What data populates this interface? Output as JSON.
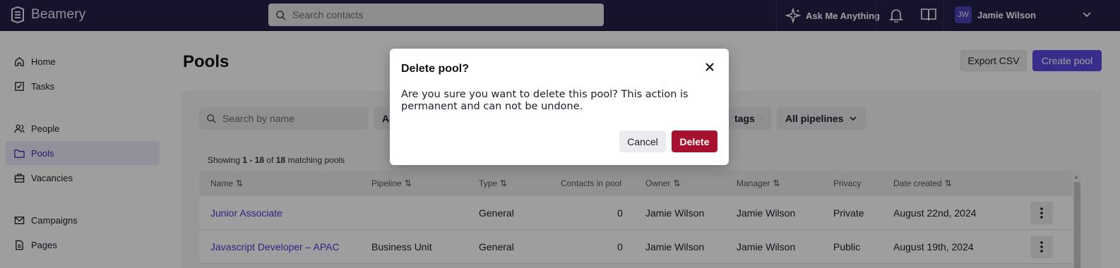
{
  "app": {
    "brand": "Beamery"
  },
  "topbar": {
    "search_placeholder": "Search contacts",
    "ask_label": "Ask Me Anything",
    "user": {
      "initials": "JW",
      "name": "Jamie Wilson"
    }
  },
  "sidebar": {
    "items": [
      {
        "label": "Home",
        "icon": "home-icon"
      },
      {
        "label": "Tasks",
        "icon": "tasks-icon"
      },
      {
        "label": "People",
        "icon": "people-icon"
      },
      {
        "label": "Pools",
        "icon": "pools-icon",
        "active": true
      },
      {
        "label": "Vacancies",
        "icon": "briefcase-icon"
      },
      {
        "label": "Campaigns",
        "icon": "mail-icon"
      },
      {
        "label": "Pages",
        "icon": "pages-icon"
      }
    ]
  },
  "main": {
    "title": "Pools",
    "export_label": "Export CSV",
    "create_label": "Create pool",
    "search_placeholder": "Search by name",
    "filter_partial": "A",
    "filters": [
      "tags",
      "All pipelines"
    ],
    "showing": {
      "prefix": "Showing ",
      "range": "1 - 18",
      "mid": " of ",
      "total": "18",
      "suffix": " matching pools"
    }
  },
  "table": {
    "columns": [
      {
        "label": "Name",
        "sortable": true
      },
      {
        "label": "Pipeline",
        "sortable": true
      },
      {
        "label": "Type",
        "sortable": true
      },
      {
        "label": "Contacts in pool",
        "sortable": false
      },
      {
        "label": "Owner",
        "sortable": true
      },
      {
        "label": "Manager",
        "sortable": true
      },
      {
        "label": "Privacy",
        "sortable": false
      },
      {
        "label": "Date created",
        "sortable": true
      }
    ],
    "rows": [
      {
        "name": "Junior Associate",
        "pipeline": "",
        "type": "General",
        "contacts": "0",
        "owner": "Jamie Wilson",
        "manager": "Jamie Wilson",
        "privacy": "Private",
        "date": "August 22nd, 2024"
      },
      {
        "name": "Javascript Developer – APAC",
        "pipeline": "Business Unit",
        "type": "General",
        "contacts": "0",
        "owner": "Jamie Wilson",
        "manager": "Jamie Wilson",
        "privacy": "Public",
        "date": "August 19th, 2024"
      }
    ]
  },
  "modal": {
    "title": "Delete pool?",
    "body": "Are you sure you want to delete this pool? This action is permanent and can not be undone.",
    "cancel_label": "Cancel",
    "delete_label": "Delete"
  },
  "colors": {
    "topbar": "#241f4a",
    "accent": "#5b4ae0",
    "danger": "#a8102f"
  }
}
